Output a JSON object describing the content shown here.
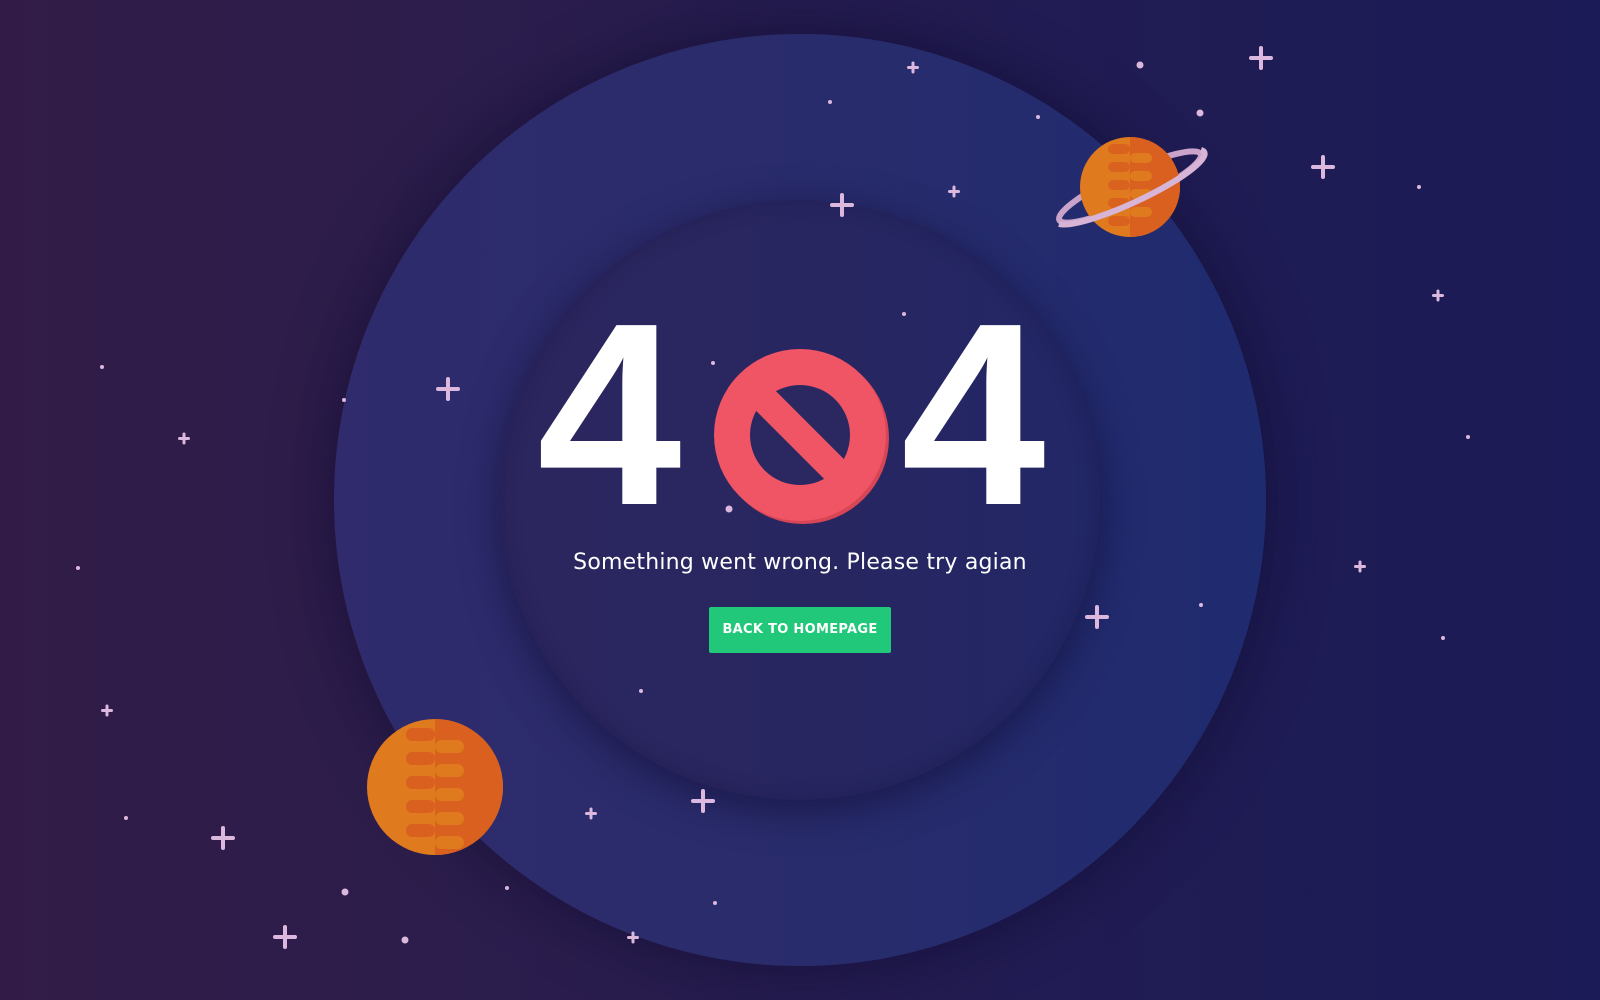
{
  "error": {
    "digit_left": "4",
    "digit_right": "4",
    "message": "Something went wrong. Please try agian",
    "button_label": "BACK TO HOMEPAGE"
  },
  "colors": {
    "background_left": "#321c47",
    "background_right": "#1b1b57",
    "outer_circle": "#2a2c6c",
    "inner_circle": "#282660",
    "no_sign": "#ef5565",
    "button": "#22c87a",
    "planet_orange": "#e07a1f",
    "star": "#dcb8de"
  },
  "icons": {
    "no_sign": "prohibited-icon",
    "ringed_planet": "saturn-planet-icon",
    "planet": "planet-icon",
    "star": "sparkle-star-icon"
  }
}
